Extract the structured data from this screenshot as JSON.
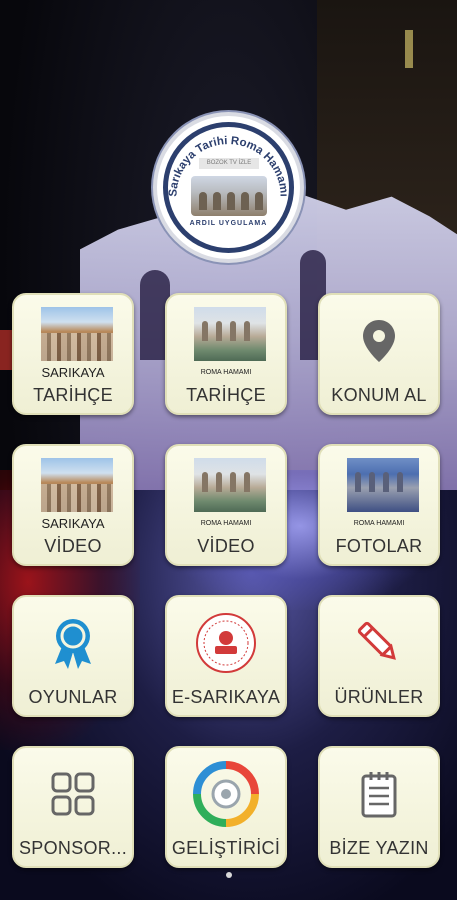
{
  "logo": {
    "title": "Sarıkaya Tarihi Roma Hamamı",
    "subtitle": "BOZOK TV İZLE",
    "brand": "ARDIL UYGULAMA"
  },
  "tiles": [
    {
      "small": "SARIKAYA",
      "label": "TARİHÇE",
      "icon": "sarikaya-city-photo"
    },
    {
      "small": "ROMA HAMAMI",
      "label": "TARİHÇE",
      "icon": "roma-hamami-photo"
    },
    {
      "small": "",
      "label": "KONUM AL",
      "icon": "location-pin-icon"
    },
    {
      "small": "SARIKAYA",
      "label": "VİDEO",
      "icon": "sarikaya-city-photo"
    },
    {
      "small": "ROMA HAMAMI",
      "label": "VİDEO",
      "icon": "roma-hamami-photo"
    },
    {
      "small": "ROMA HAMAMI",
      "label": "FOTOLAR",
      "icon": "roma-hamami-night-photo"
    },
    {
      "small": "",
      "label": "OYUNLAR",
      "icon": "award-ribbon-icon"
    },
    {
      "small": "",
      "label": "E-SARIKAYA",
      "icon": "seal-stamp-icon"
    },
    {
      "small": "",
      "label": "ÜRÜNLER",
      "icon": "pencil-icon"
    },
    {
      "small": "",
      "label": "SPONSOR...",
      "icon": "grid-apps-icon"
    },
    {
      "small": "",
      "label": "GELİŞTİRİCİ",
      "icon": "gear-cycle-icon"
    },
    {
      "small": "",
      "label": "BİZE YAZIN",
      "icon": "notepad-icon"
    }
  ],
  "colors": {
    "tile_bg": "#f5f5df",
    "logo_navy": "#2c3f6e",
    "icon_blue": "#1f8fd0",
    "icon_red": "#d23a3a"
  }
}
